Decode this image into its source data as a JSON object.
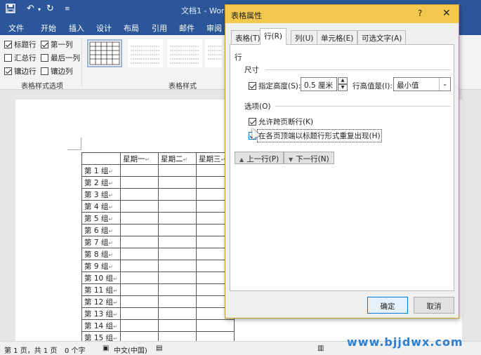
{
  "titlebar": {
    "doc_title": "文档1 - Word",
    "save_icon": "save-icon",
    "undo_icon": "undo-icon",
    "redo_icon": "redo-icon"
  },
  "tabs": [
    "文件",
    "开始",
    "插入",
    "设计",
    "布局",
    "引用",
    "邮件",
    "审阅"
  ],
  "ribbon": {
    "options": [
      {
        "label": "标题行",
        "checked": true
      },
      {
        "label": "第一列",
        "checked": true
      },
      {
        "label": "汇总行",
        "checked": false
      },
      {
        "label": "最后一列",
        "checked": false
      },
      {
        "label": "镶边行",
        "checked": true
      },
      {
        "label": "镶边列",
        "checked": false
      }
    ],
    "group_options_label": "表格样式选项",
    "group_styles_label": "表格样式"
  },
  "table": {
    "headers": [
      "",
      "星期一",
      "星期二",
      "星期三"
    ],
    "rows": [
      "第 1 组",
      "第 2 组",
      "第 3 组",
      "第 4 组",
      "第 5 组",
      "第 6 组",
      "第 7 组",
      "第 8 组",
      "第 9 组",
      "第 10 组",
      "第 11 组",
      "第 12 组",
      "第 13 组",
      "第 14 组",
      "第 15 组"
    ]
  },
  "statusbar": {
    "page": "第 1 页，共 1 页",
    "words": "0 个字",
    "lang": "中文(中国)"
  },
  "watermark": "www.bjjdwx.com",
  "dialog": {
    "title": "表格属性",
    "help": "?",
    "close": "✕",
    "tabs": [
      "表格(T)",
      "行(R)",
      "列(U)",
      "单元格(E)",
      "可选文字(A)"
    ],
    "active_tab": "行(R)",
    "section_row": "行",
    "section_size": "尺寸",
    "specify_height_label": "指定高度(S):",
    "specify_height_checked": true,
    "height_value": "0.5 厘米",
    "row_height_is_label": "行高值是(I):",
    "row_height_is_value": "最小值",
    "section_options": "选项(O)",
    "allow_break_label": "允许跨页断行(K)",
    "allow_break_checked": true,
    "repeat_header_label": "在各页顶端以标题行形式重复出现(H)",
    "repeat_header_checked": true,
    "prev_row": "上一行(P)",
    "next_row": "下一行(N)",
    "ok": "确定",
    "cancel": "取消"
  }
}
